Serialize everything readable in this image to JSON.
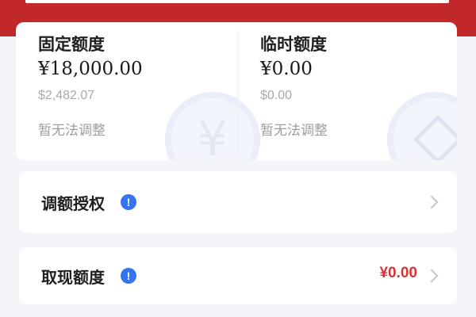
{
  "limits": {
    "fixed": {
      "title": "固定额度",
      "amount": "¥18,000.00",
      "usd": "$2,482.07",
      "note": "暂无法调整",
      "watermark_icon": "yen-coin-icon"
    },
    "temporary": {
      "title": "临时额度",
      "amount": "¥0.00",
      "usd": "$0.00",
      "note": "暂无法调整",
      "watermark_icon": "diamond-coin-icon"
    }
  },
  "rows": {
    "auth": {
      "label": "调额授权",
      "info_icon": "!"
    },
    "cash": {
      "label": "取现额度",
      "info_icon": "!",
      "value": "¥0.00"
    }
  },
  "colors": {
    "header_red": "#c0282a",
    "accent_blue": "#3574f0",
    "value_red": "#d6333b"
  }
}
